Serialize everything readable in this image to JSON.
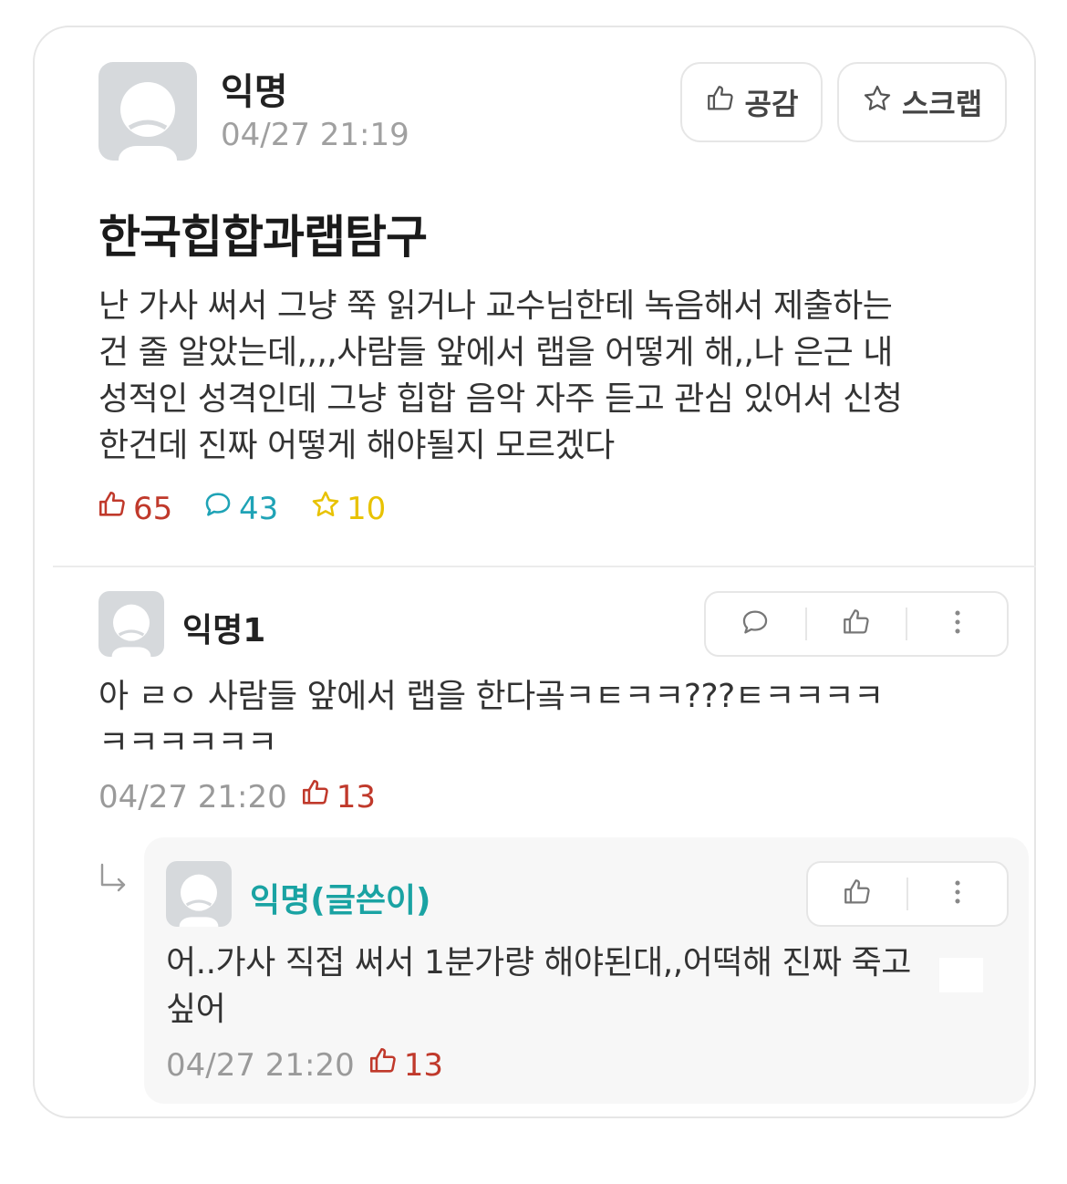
{
  "post": {
    "author": "익명",
    "timestamp": "04/27 21:19",
    "buttons": {
      "like_label": "공감",
      "scrap_label": "스크랩"
    },
    "title": "한국힙합과랩탐구",
    "body_lines": [
      "난 가사 써서 그냥 쭉 읽거나 교수님한테 녹음해서 제출하는",
      "건 줄 알았는데,,,,사람들 앞에서 랩을 어떻게 해,,나 은근 내",
      "성적인 성격인데 그냥 힙합 음악 자주 듣고 관심 있어서 신청",
      "한건데 진짜 어떻게 해야될지 모르겠다"
    ],
    "stats": {
      "likes": "65",
      "comments": "43",
      "scraps": "10"
    }
  },
  "comments": [
    {
      "author": "익명1",
      "lines": [
        "아 ㄹㅇ 사람들 앞에서 랩을 한다곸ㅋㅌㅋㅋ???ㅌㅋㅋㅋㅋ",
        "ㅋㅋㅋㅋㅋㅋ"
      ],
      "timestamp": "04/27 21:20",
      "likes": "13"
    }
  ],
  "reply": {
    "author": "익명(글쓴이)",
    "lines": [
      "어..가사 직접 써서 1분가량 해야된대,,어떡해 진짜 죽고",
      "싶어"
    ],
    "timestamp": "04/27 21:20",
    "likes": "13"
  },
  "colors": {
    "like_red": "#c0392b",
    "comment_cyan": "#1fa3b6",
    "scrap_yellow": "#e8c200",
    "op_name_teal": "#1aa3a3",
    "meta_gray": "#9a9a9a"
  },
  "icons": {
    "like": "thumbs-up-icon",
    "comment": "speech-bubble-icon",
    "scrap": "star-icon",
    "more": "vertical-dots-icon",
    "reply_arrow": "reply-arrow-icon"
  }
}
